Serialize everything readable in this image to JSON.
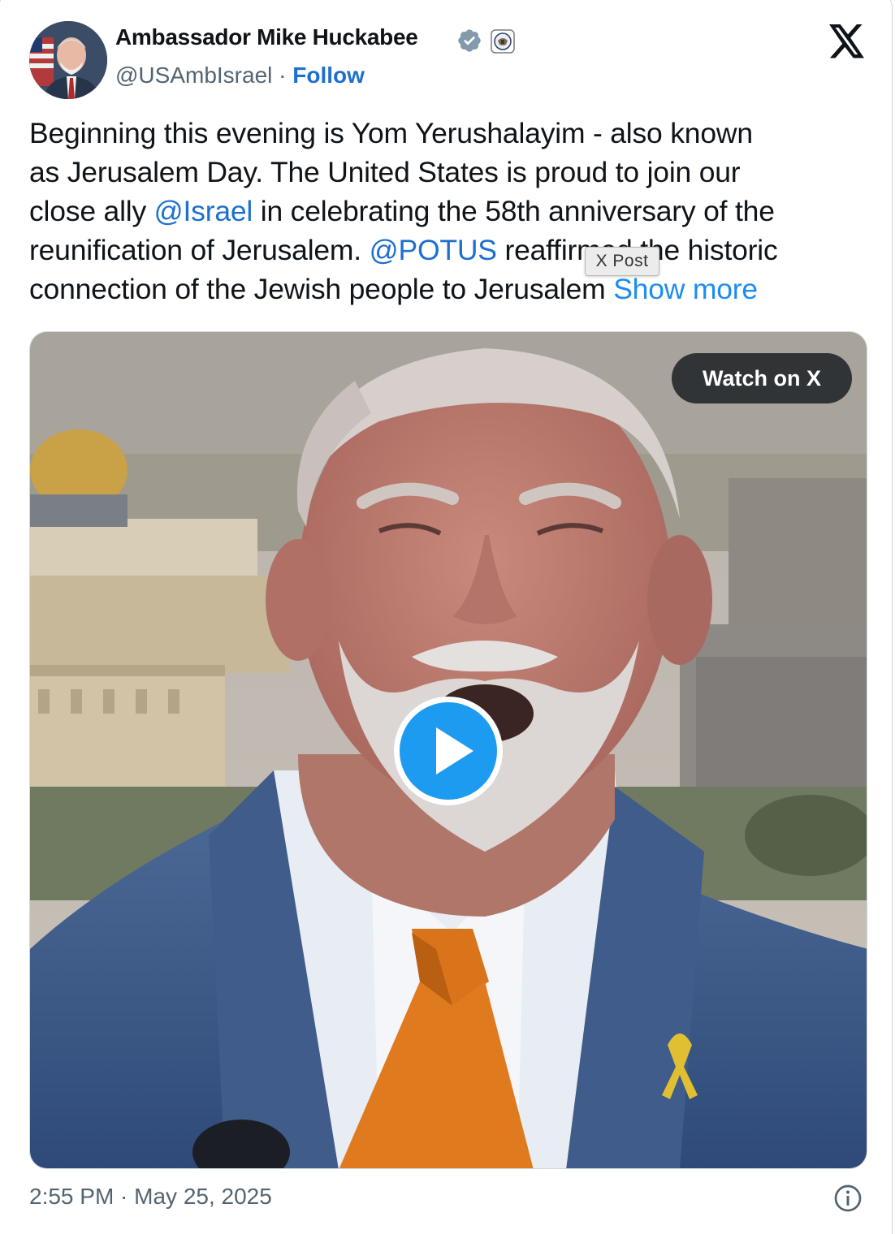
{
  "author": {
    "display_name": "Ambassador Mike Huckabee",
    "handle": "@USAmbIsrael",
    "separator": " · ",
    "follow_label": "Follow",
    "verified_color": "#829aab"
  },
  "tweet": {
    "lines": [
      [
        {
          "t": "Beginning this evening is Yom Yerushalayim - also known"
        }
      ],
      [
        {
          "t": "as Jerusalem Day. The United States is proud to join our"
        }
      ],
      [
        {
          "t": "close ally "
        },
        {
          "t": "@Israel",
          "k": "mention"
        },
        {
          "t": " in celebrating the 58th anniversary of the"
        }
      ],
      [
        {
          "t": "reunification of Jerusalem. "
        },
        {
          "t": "@POTUS",
          "k": "mention"
        },
        {
          "t": " reaffirmed the historic"
        }
      ],
      [
        {
          "t": "connection of the Jewish people to Jerusalem "
        },
        {
          "t": "Show more",
          "k": "more"
        }
      ]
    ]
  },
  "tooltip": {
    "text": "X Post"
  },
  "media": {
    "watch_label": "Watch on X"
  },
  "footer": {
    "timestamp": "2:55 PM · May 25, 2025"
  },
  "colors": {
    "link": "#1d6fd0",
    "play": "#1d9bf0",
    "tie": "#e07a1f",
    "suit": "#3d5a87"
  }
}
